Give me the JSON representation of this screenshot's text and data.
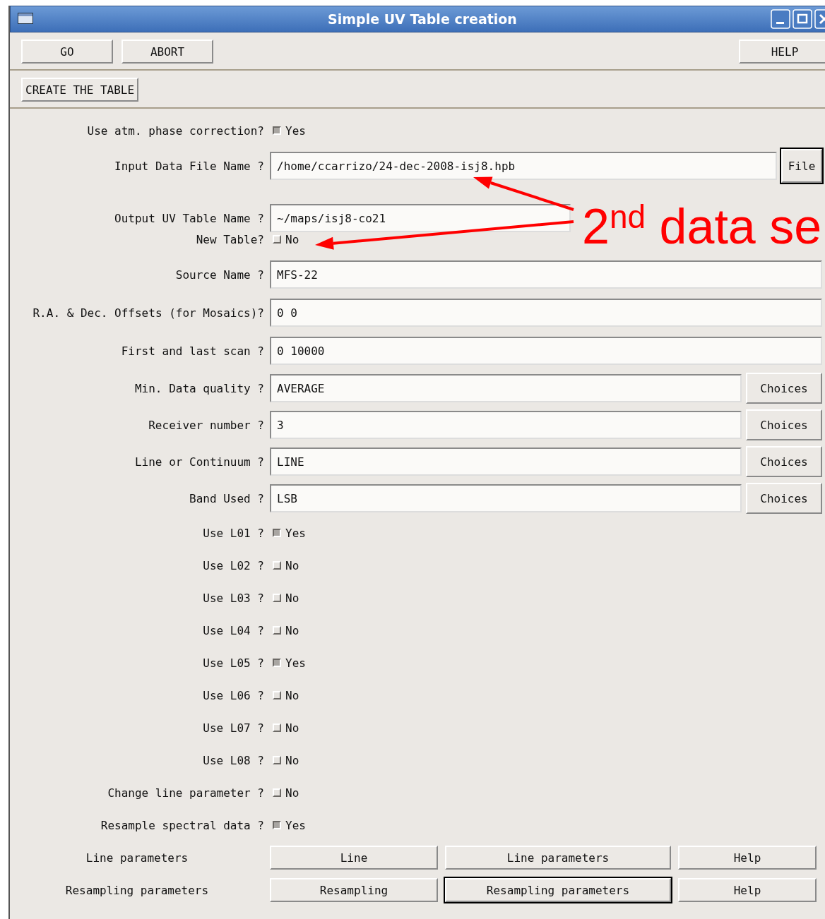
{
  "window": {
    "title": "Simple UV Table creation"
  },
  "toolbar": {
    "left_buttons": [
      "GO",
      "ABORT"
    ],
    "right_buttons": [
      "HELP"
    ]
  },
  "section_button": "CREATE THE TABLE",
  "rows": [
    {
      "kind": "checkbox",
      "label": "Use atm. phase correction?",
      "checked": true,
      "option": "Yes"
    },
    {
      "kind": "file",
      "label": "Input Data File Name ?",
      "value": "/home/ccarrizo/24-dec-2008-isj8.hpb",
      "button": "File",
      "focused": true
    },
    {
      "kind": "field",
      "label": "Output UV Table Name ?",
      "value": "~/maps/isj8-co21",
      "annotation": "2$^{nd}$ data se"
    },
    {
      "kind": "checkbox",
      "label": "New Table?",
      "checked": false,
      "option": "No"
    },
    {
      "kind": "field",
      "label": "Source Name ?",
      "value": "MFS-22"
    },
    {
      "kind": "field",
      "label": "R.A. & Dec. Offsets (for Mosaics)?",
      "value": "0 0"
    },
    {
      "kind": "field",
      "label": "First and last scan ?",
      "value": "0 10000"
    },
    {
      "kind": "choice",
      "label": "Min. Data quality ?",
      "value": "AVERAGE",
      "button": "Choices"
    },
    {
      "kind": "choice",
      "label": "Receiver number ?",
      "value": "3",
      "button": "Choices"
    },
    {
      "kind": "choice",
      "label": "Line or Continuum ?",
      "value": "LINE",
      "button": "Choices"
    },
    {
      "kind": "choice",
      "label": "Band Used ?",
      "value": "LSB",
      "button": "Choices"
    },
    {
      "kind": "checkbox",
      "label": "Use L01 ?",
      "checked": true,
      "option": "Yes"
    },
    {
      "kind": "checkbox",
      "label": "Use L02 ?",
      "checked": false,
      "option": "No"
    },
    {
      "kind": "checkbox",
      "label": "Use L03 ?",
      "checked": false,
      "option": "No"
    },
    {
      "kind": "checkbox",
      "label": "Use L04 ?",
      "checked": false,
      "option": "No"
    },
    {
      "kind": "checkbox",
      "label": "Use L05 ?",
      "checked": true,
      "option": "Yes"
    },
    {
      "kind": "checkbox",
      "label": "Use L06 ?",
      "checked": false,
      "option": "No"
    },
    {
      "kind": "checkbox",
      "label": "Use L07 ?",
      "checked": false,
      "option": "No"
    },
    {
      "kind": "checkbox",
      "label": "Use L08 ?",
      "checked": false,
      "option": "No"
    },
    {
      "kind": "checkbox",
      "label": "Change line parameter ?",
      "checked": false,
      "option": "No"
    },
    {
      "kind": "checkbox",
      "label": "Resample spectral data ?",
      "checked": true,
      "option": "Yes"
    },
    {
      "kind": "buttons",
      "label": "Line parameters",
      "buttons": [
        {
          "label": "Line",
          "focused": false
        },
        {
          "label": "Line parameters",
          "focused": false
        },
        {
          "label": "Help",
          "focused": false
        }
      ]
    },
    {
      "kind": "buttons",
      "label": "Resampling parameters",
      "buttons": [
        {
          "label": "Resampling",
          "focused": false
        },
        {
          "label": "Resampling parameters",
          "focused": true
        },
        {
          "label": "Help",
          "focused": false
        }
      ]
    }
  ]
}
